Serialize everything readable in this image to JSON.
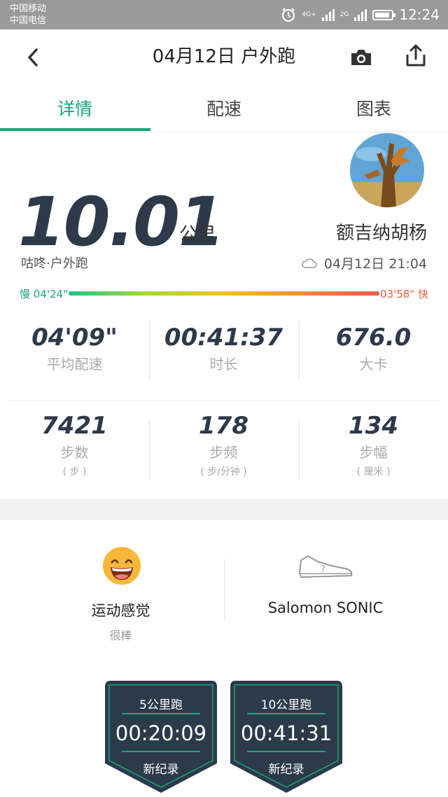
{
  "status_bar": {
    "carrier1": "中国移动",
    "carrier2": "中国电信",
    "net1": "4G+",
    "net2": "2G",
    "time": "12:24"
  },
  "header": {
    "title": "04月12日 户外跑"
  },
  "tabs": [
    {
      "label": "详情",
      "active": true
    },
    {
      "label": "配速",
      "active": false
    },
    {
      "label": "图表",
      "active": false
    }
  ],
  "summary": {
    "distance": "10.01",
    "unit": "公里",
    "username": "额吉纳胡杨",
    "source": "咕咚·户外跑",
    "datetime": "04月12日 21:04"
  },
  "pace_range": {
    "slow_label": "慢 04'24\"",
    "fast_label": "03'58\" 快"
  },
  "stats_row1": [
    {
      "value": "04'09\"",
      "label": "平均配速"
    },
    {
      "value": "00:41:37",
      "label": "时长"
    },
    {
      "value": "676.0",
      "label": "大卡"
    }
  ],
  "stats_row2": [
    {
      "value": "7421",
      "label": "步数",
      "sub": "( 步 )"
    },
    {
      "value": "178",
      "label": "步频",
      "sub": "( 步/分钟 )"
    },
    {
      "value": "134",
      "label": "步幅",
      "sub": "( 厘米 )"
    }
  ],
  "feeling": {
    "label": "运动感觉",
    "value": "很棒"
  },
  "shoe": {
    "label": "Salomon SONIC"
  },
  "records": [
    {
      "title": "5公里跑",
      "time": "00:20:09",
      "tag": "新纪录"
    },
    {
      "title": "10公里跑",
      "time": "00:41:31",
      "tag": "新纪录"
    }
  ],
  "colors": {
    "accent": "#1aa67b",
    "dark": "#2c3a4a",
    "fast": "#e06040"
  }
}
